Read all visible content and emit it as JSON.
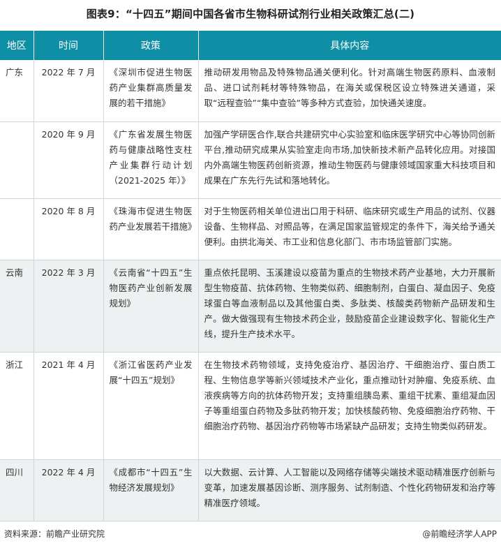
{
  "title": "图表9：“十四五”期间中国各省市生物科研试剂行业相关政策汇总(二)",
  "headers": [
    "地区",
    "时间",
    "政策",
    "具体内容"
  ],
  "rows": [
    {
      "region": "广东",
      "time": "2022 年 7 月",
      "policy": "《深圳市促进生物医药产业集群高质量发展的若干措施》",
      "content": "推动研发用物品及特殊物品通关便利化。针对高端生物医药原料、血液制品、进口试剂耗材等特殊物品，在海关或保税区设立特殊进关通道，采取“远程查验”“集中查验”等多种方式查验，加快通关速度。"
    },
    {
      "region": "",
      "time": "2020 年 9 月",
      "policy": "《广东省发展生物医药与健康战略性支柱产业集群行动计划（2021-2025 年）》",
      "content": "加强产学研医合作,联合共建研究中心实验室和临床医学研究中心等协同创新平台,推动研究成果从实验室走向市场,加快新技术新产品转化应用。对接国内外高端生物医药创新资源，推动生物医药与健康领域国家重大科技项目和成果在广东先行先试和落地转化。"
    },
    {
      "region": "",
      "time": "2020 年 8 月",
      "policy": "《珠海市促进生物医药产业发展若干措施》",
      "content": "对于生物医药相关单位进出口用于科研、临床研究或生产用品的试剂、仪器设备、生物样品、对照品等，在满足国家监管规定的条件下，海关给予通关便利。由拱北海关、市工业和信息化部门、市市场监管部门实施。"
    },
    {
      "region": "云南",
      "time": "2022 年 3 月",
      "policy": "《云南省“十四五”生物医药产业创新发展规划》",
      "content": "重点依托昆明、玉溪建设以疫苗为重点的生物技术药产业基地，大力开展新型生物疫苗、抗体药物、生物类似药、细胞制剂，白蛋白、凝血因子、免疫球蛋白等血液制品以及其他蛋白类、多肽类、核酸类药物新产品研发和生产。做大做强现有生物技术药企业，鼓励疫苗企业建设数字化、智能化生产线，提升生产技术水平。"
    },
    {
      "region": "浙江",
      "time": "2021 年 4 月",
      "policy": "《浙江省医药产业发展“十四五”规划》",
      "content": "在生物技术药物领域，支持免疫治疗、基因治疗、干细胞治疗、蛋白质工程、生物信息学等新兴领域技术产业化，重点推动针对肿瘤、免疫系统、血液疾病等方向的抗体药物开发；支持重组胰岛素、重组干扰素、重组凝血因子等重组蛋白药物及多肽药物开发；加快核酸药物、免疫细胞治疗药物、干细胞治疗药物、基因治疗药物等市场紧缺产品研发；支持生物类似药研发。"
    },
    {
      "region": "四川",
      "time": "2022 年 4 月",
      "policy": "《成都市“十四五”生物经济发展规划》",
      "content": "以大数据、云计算、人工智能以及网络存储等尖端技术驱动精准医疗创新与变革，加速发展基因诊断、测序服务、试剂制造、个性化药物研发和治疗等精准医疗领域。"
    }
  ],
  "footer": {
    "source": "资料来源：前瞻产业研究院",
    "brand": "@前瞻经济学人APP"
  },
  "colors": {
    "header_bg": "#0f8fa5",
    "shade_bg": "#eef1f2"
  }
}
